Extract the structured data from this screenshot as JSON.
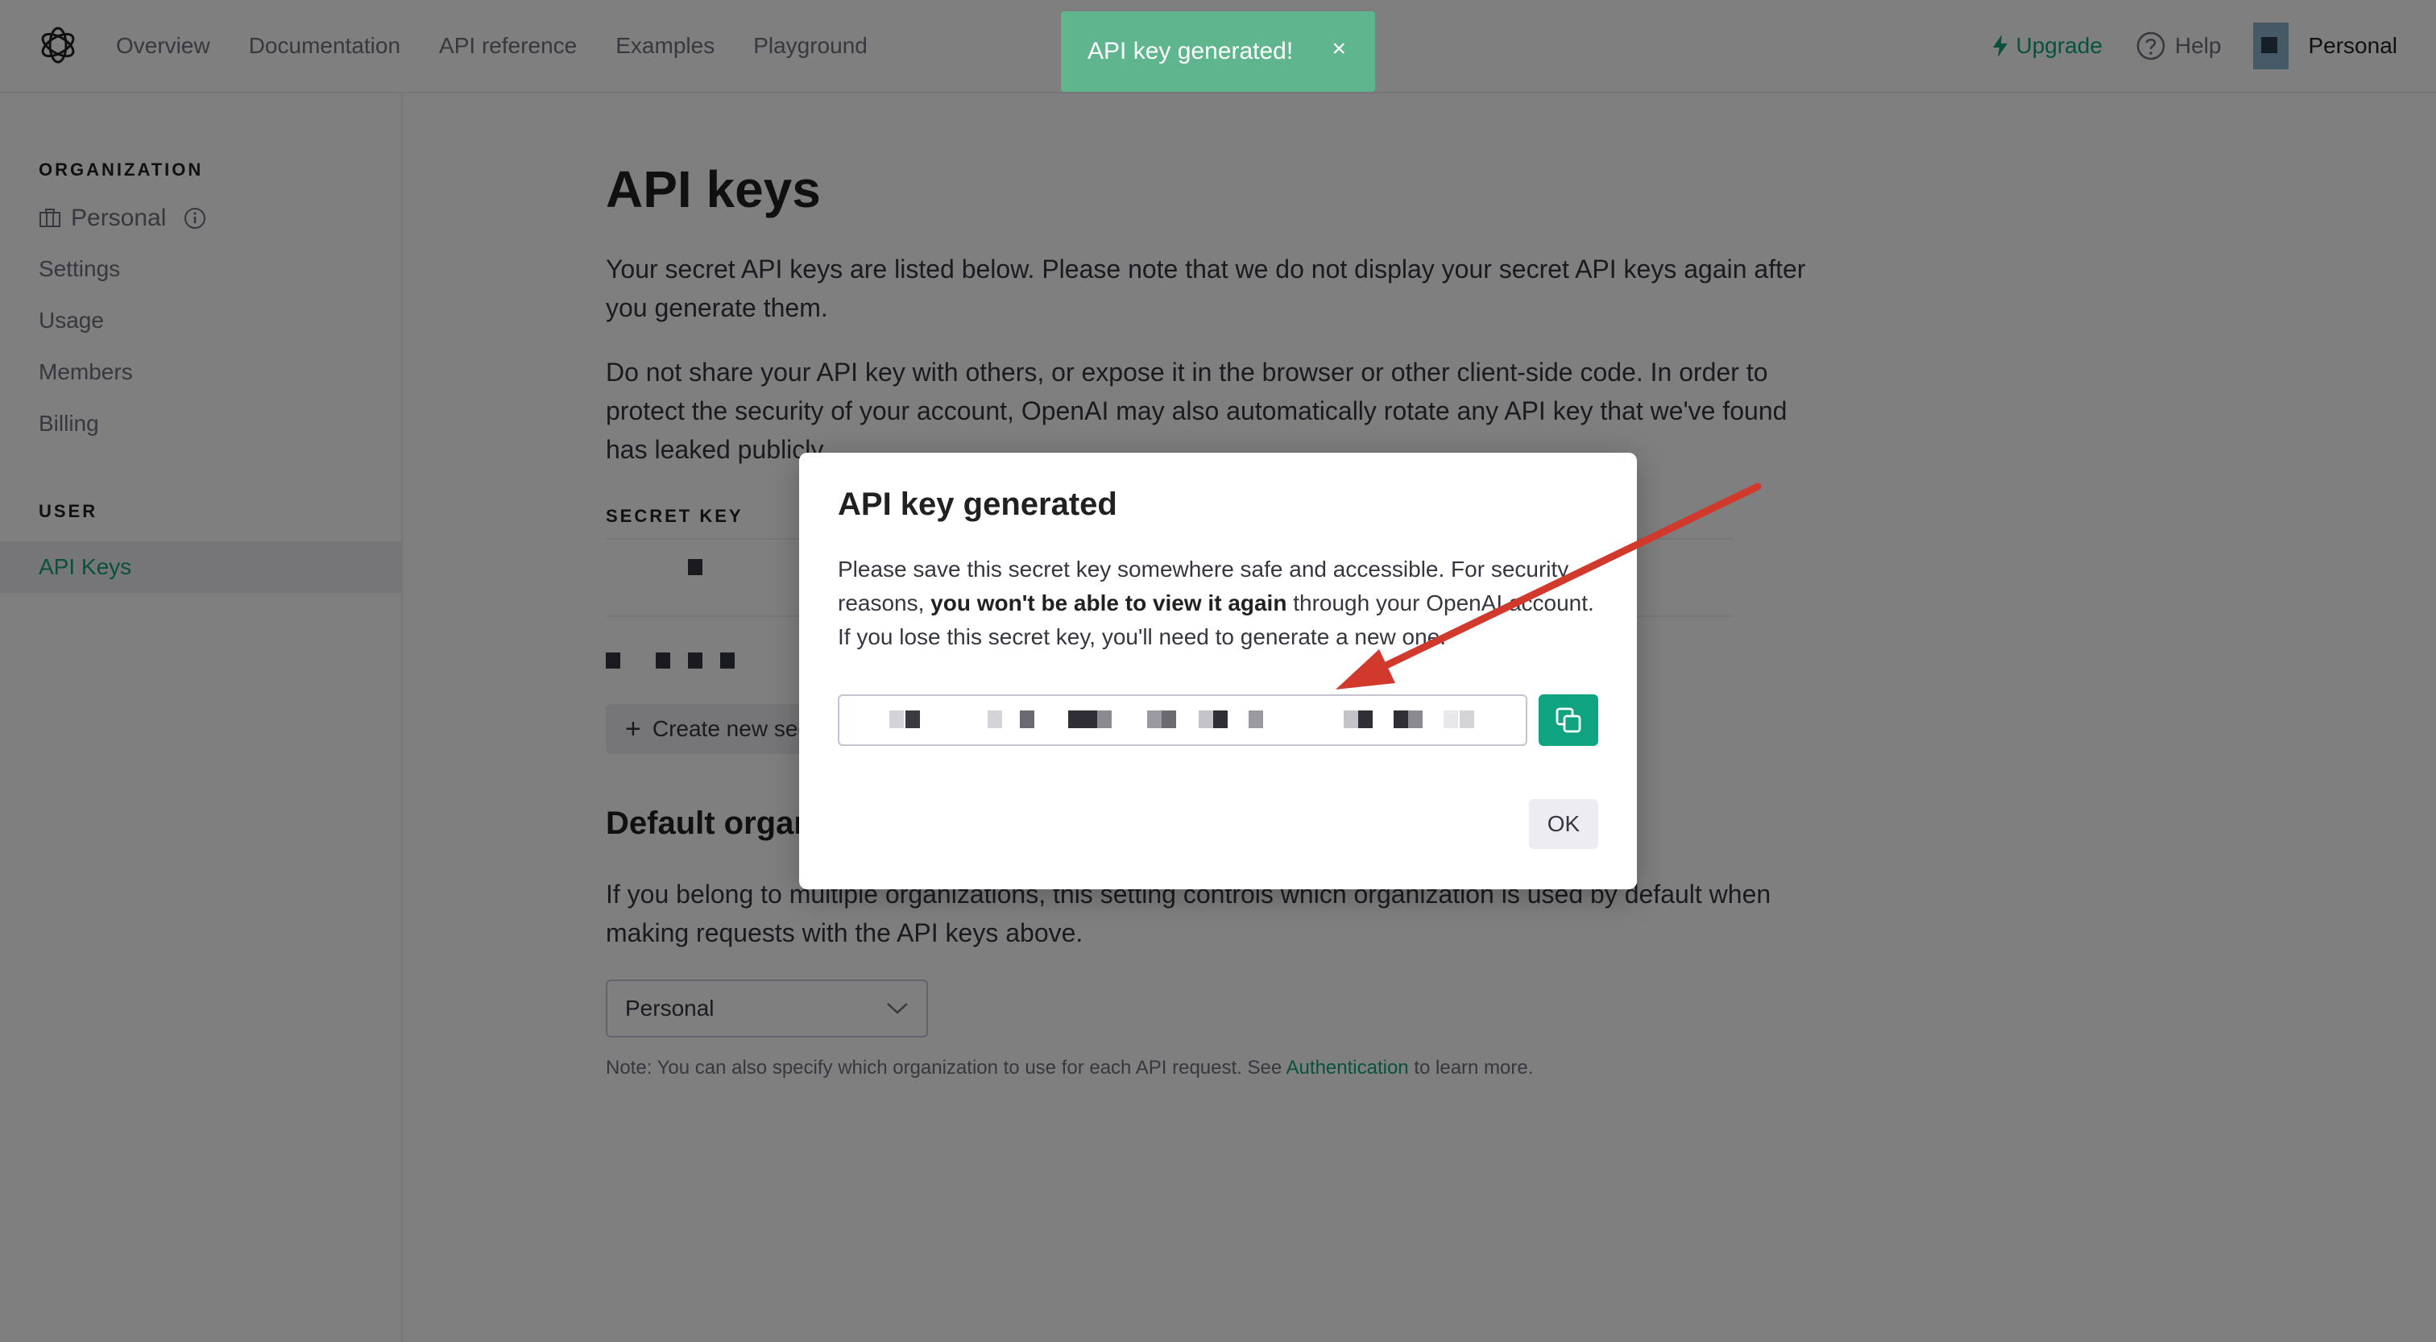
{
  "nav": {
    "links": [
      "Overview",
      "Documentation",
      "API reference",
      "Examples",
      "Playground"
    ],
    "upgrade": "Upgrade",
    "help": "Help",
    "account": "Personal"
  },
  "sidebar": {
    "org_heading": "ORGANIZATION",
    "org_name": "Personal",
    "items": [
      "Settings",
      "Usage",
      "Members",
      "Billing"
    ],
    "user_heading": "USER",
    "active_item": "API Keys"
  },
  "main": {
    "title": "API keys",
    "para1": "Your secret API keys are listed below. Please note that we do not display your secret API keys again after you generate them.",
    "para2": "Do not share your API key with others, or expose it in the browser or other client-side code. In order to protect the security of your account, OpenAI may also automatically rotate any API key that we've found has leaked publicly.",
    "col_secret_key": "SECRET KEY",
    "create_button": "Create new secret key",
    "default_org_title": "Default organization",
    "default_org_text": "If you belong to multiple organizations, this setting controls which organization is used by default when making requests with the API keys above.",
    "select_value": "Personal",
    "note_prefix": "Note: You can also specify which organization to use for each API request. See ",
    "note_link": "Authentication",
    "note_suffix": " to learn more."
  },
  "toast": {
    "text": "API key generated!",
    "close": "×"
  },
  "modal": {
    "title": "API key generated",
    "text_part1": "Please save this secret key somewhere safe and accessible. For security reasons, ",
    "text_bold": "you won't be able to view it again",
    "text_part2": " through your OpenAI account. If you lose this secret key, you'll need to generate a new one.",
    "ok_label": "OK"
  },
  "colors": {
    "accent": "#10a37f",
    "toast": "#5fb68e",
    "annotation_arrow": "#d0392b"
  },
  "icons": {
    "logo": "openai-logo-icon",
    "upgrade": "lightning-icon",
    "help": "question-circle-icon",
    "org": "building-icon",
    "info": "info-icon",
    "copy": "copy-icon",
    "chevron": "chevron-down-icon"
  }
}
